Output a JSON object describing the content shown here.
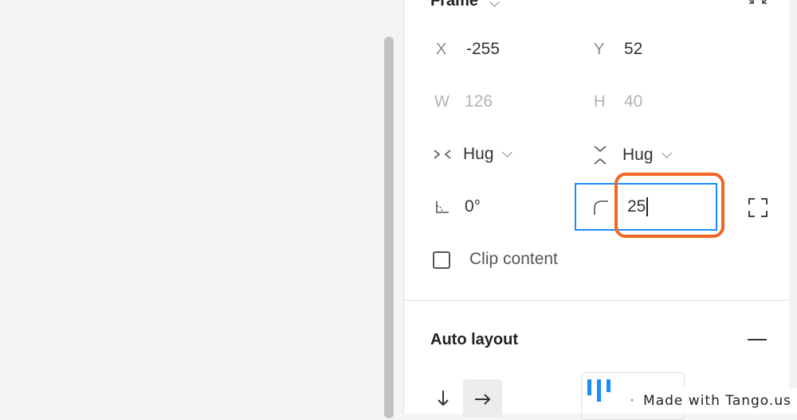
{
  "colors": {
    "accent": "#1a8cff",
    "highlight": "#f26522"
  },
  "frame_section": {
    "title": "Frame",
    "collapse_icon": "collapse-icon",
    "x": {
      "label": "X",
      "value": "-255"
    },
    "y": {
      "label": "Y",
      "value": "52"
    },
    "w": {
      "label": "W",
      "value": "126"
    },
    "h": {
      "label": "H",
      "value": "40"
    },
    "width_mode": {
      "icon": "horizontal-resize-icon",
      "value": "Hug"
    },
    "height_mode": {
      "icon": "vertical-resize-icon",
      "value": "Hug"
    },
    "rotation": {
      "icon": "rotation-icon",
      "value": "0°"
    },
    "corner_radius": {
      "icon": "corner-radius-icon",
      "value": "25"
    },
    "independent_corners_icon": "independent-corners-icon",
    "clip_content": {
      "label": "Clip content",
      "checked": false
    }
  },
  "auto_layout": {
    "title": "Auto layout",
    "remove_icon": "minus-icon",
    "direction_vertical_icon": "arrow-down-icon",
    "direction_horizontal_icon": "arrow-right-icon",
    "selected_direction": "horizontal",
    "alignment_icon": "align-top-icon"
  },
  "watermark": "Made with Tango.us"
}
